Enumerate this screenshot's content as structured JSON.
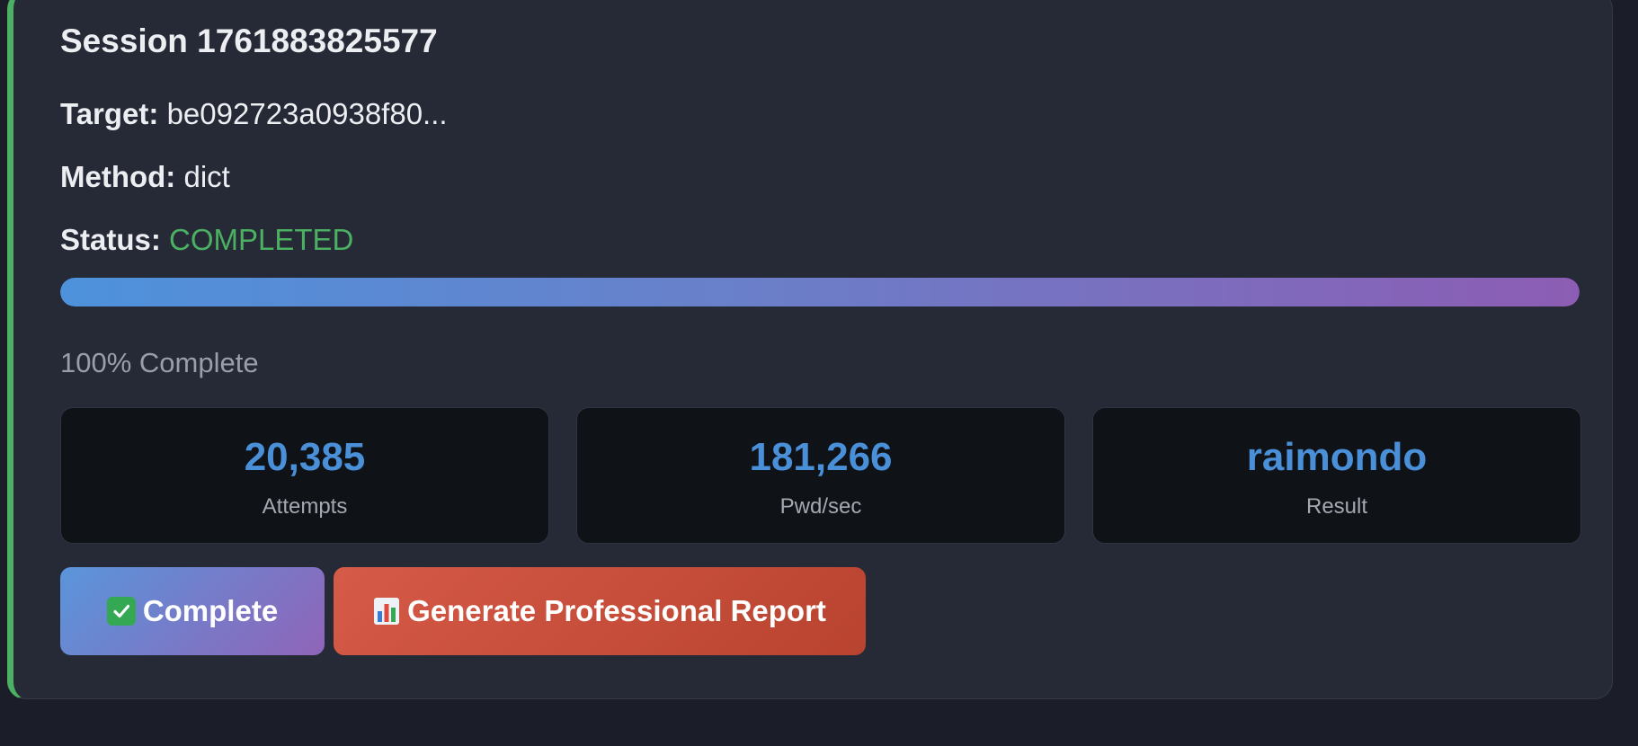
{
  "session": {
    "title": "Session 1761883825577",
    "target_label": "Target:",
    "target_value": "be092723a0938f80...",
    "method_label": "Method:",
    "method_value": "dict",
    "status_label": "Status:",
    "status_value": "COMPLETED",
    "status_color": "#4bb061",
    "accent_color": "#4bb061"
  },
  "progress": {
    "fraction": 1.0,
    "text": "100% Complete"
  },
  "stats": [
    {
      "value": "20,385",
      "label": "Attempts"
    },
    {
      "value": "181,266",
      "label": "Pwd/sec"
    },
    {
      "value": "raimondo",
      "label": "Result"
    }
  ],
  "actions": {
    "complete_label": "Complete",
    "complete_icon": "check-mark-icon",
    "report_label": "Generate Professional Report",
    "report_icon": "bar-chart-icon"
  }
}
